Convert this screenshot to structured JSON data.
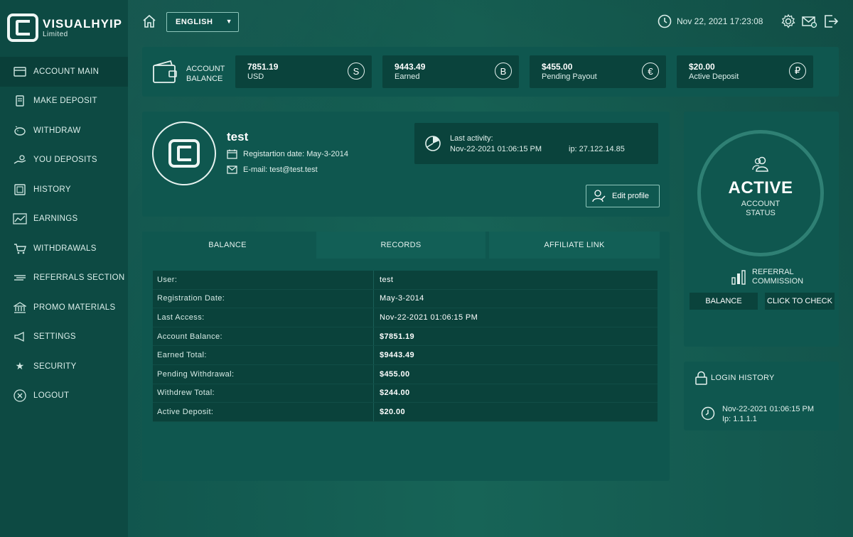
{
  "brand": {
    "title": "VISUALHYIP",
    "subtitle": "Limited"
  },
  "sidebar": {
    "items": [
      {
        "label": "ACCOUNT MAIN",
        "icon": "account-icon",
        "active": true
      },
      {
        "label": "MAKE DEPOSIT",
        "icon": "deposit-icon"
      },
      {
        "label": "WITHDRAW",
        "icon": "piggy-bank-icon"
      },
      {
        "label": "YOU DEPOSITS",
        "icon": "hand-coin-icon"
      },
      {
        "label": "HISTORY",
        "icon": "history-icon"
      },
      {
        "label": "EARNINGS",
        "icon": "chart-icon"
      },
      {
        "label": "WITHDRAWALS",
        "icon": "cart-icon"
      },
      {
        "label": "REFERRALS SECTION",
        "icon": "referrals-icon"
      },
      {
        "label": "PROMO MATERIALS",
        "icon": "promo-icon"
      },
      {
        "label": "SETTINGS",
        "icon": "megaphone-icon"
      },
      {
        "label": "SECURITY",
        "icon": "star-icon"
      },
      {
        "label": "LOGOUT",
        "icon": "close-circle-icon"
      }
    ]
  },
  "topbar": {
    "language": "ENGLISH",
    "datetime": "Nov 22, 2021 17:23:08"
  },
  "balances": {
    "label_line1": "ACCOUNT",
    "label_line2": "BALANCE",
    "items": [
      {
        "value": "7851.19",
        "label": "USD",
        "symbol": "S"
      },
      {
        "value": "9443.49",
        "label": "Earned",
        "symbol": "B"
      },
      {
        "value": "$455.00",
        "label": "Pending Payout",
        "symbol": "€"
      },
      {
        "value": "$20.00",
        "label": "Active Deposit",
        "symbol": "₽"
      }
    ]
  },
  "profile": {
    "username": "test",
    "registration": "Registartion date: May-3-2014",
    "email": "E-mail: test@test.test",
    "last_activity_label": "Last activity:",
    "last_activity_time": "Nov-22-2021 01:06:15 PM",
    "ip": "ip: 27.122.14.85",
    "edit_label": "Edit profile"
  },
  "tabs": [
    "BALANCE",
    "RECORDS",
    "AFFILIATE LINK"
  ],
  "info_rows": [
    {
      "key": "User:",
      "value": "test",
      "bold": false
    },
    {
      "key": "Registration Date:",
      "value": "May-3-2014",
      "bold": false
    },
    {
      "key": "Last Access:",
      "value": "Nov-22-2021 01:06:15 PM",
      "bold": false
    },
    {
      "key": "Account Balance:",
      "value": "$7851.19",
      "bold": true
    },
    {
      "key": "Earned Total:",
      "value": "$9443.49",
      "bold": true
    },
    {
      "key": "Pending Withdrawal:",
      "value": "$455.00",
      "bold": true
    },
    {
      "key": "Withdrew Total:",
      "value": "$244.00",
      "bold": true
    },
    {
      "key": "Active Deposit:",
      "value": "$20.00",
      "bold": true
    }
  ],
  "status": {
    "word": "ACTIVE",
    "sub_line1": "ACCOUNT",
    "sub_line2": "STATUS",
    "referral_line1": "REFERRAL",
    "referral_line2": "COMMISSION",
    "balance_button": "BALANCE",
    "check_button": "CLICK TO CHECK"
  },
  "login_history": {
    "title": "LOGIN HISTORY",
    "time": "Nov-22-2021 01:06:15 PM",
    "ip": "Ip: 1.1.1.1"
  }
}
